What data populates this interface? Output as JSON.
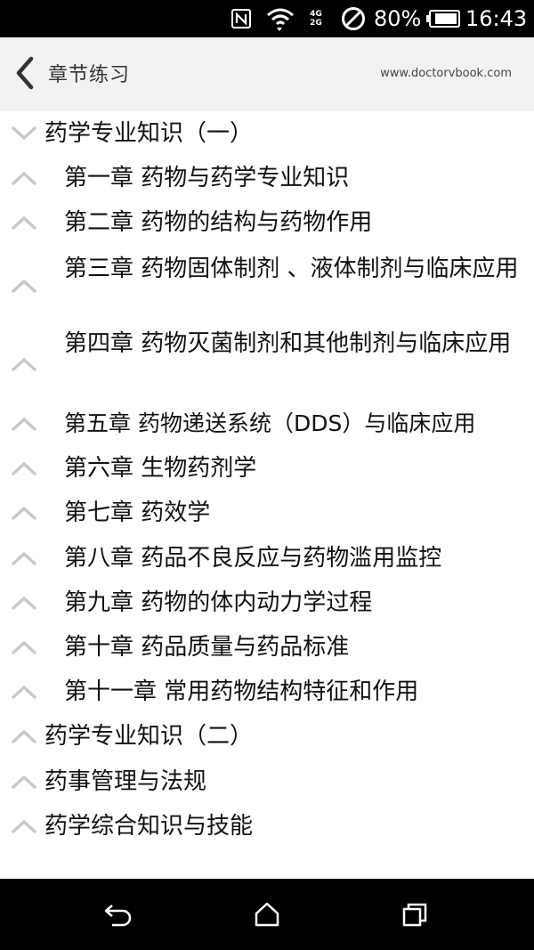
{
  "status_bar": {
    "battery_percent": "80%",
    "time": "16:43",
    "net_top": "4G",
    "net_bottom": "2G",
    "icons": [
      "nfc-icon",
      "wifi-icon",
      "cellular-signal-icon",
      "do-not-disturb-icon",
      "battery-icon"
    ]
  },
  "header": {
    "title": "章节练习",
    "site": "www.doctorvbook.com",
    "back_icon": "chevron-left-icon",
    "background": "#f2f2f2"
  },
  "tree": [
    {
      "label": "药学专业知识（一）",
      "level": 0,
      "expanded": true
    },
    {
      "label": "第一章 药物与药学专业知识",
      "level": 1,
      "expanded": false
    },
    {
      "label": "第二章 药物的结构与药物作用",
      "level": 1,
      "expanded": false
    },
    {
      "label": "第三章 药物固体制剂 、液体制剂与临床应用",
      "level": 1,
      "expanded": false
    },
    {
      "label": "第四章 药物灭菌制剂和其他制剂与临床应用",
      "level": 1,
      "expanded": false
    },
    {
      "label": "第五章 药物递送系统（DDS）与临床应用",
      "level": 1,
      "expanded": false
    },
    {
      "label": "第六章 生物药剂学",
      "level": 1,
      "expanded": false
    },
    {
      "label": "第七章 药效学",
      "level": 1,
      "expanded": false
    },
    {
      "label": "第八章 药品不良反应与药物滥用监控",
      "level": 1,
      "expanded": false
    },
    {
      "label": "第九章 药物的体内动力学过程",
      "level": 1,
      "expanded": false
    },
    {
      "label": "第十章 药品质量与药品标准",
      "level": 1,
      "expanded": false
    },
    {
      "label": "第十一章 常用药物结构特征和作用",
      "level": 1,
      "expanded": false
    },
    {
      "label": "药学专业知识（二）",
      "level": 0,
      "expanded": false
    },
    {
      "label": "药事管理与法规",
      "level": 0,
      "expanded": false
    },
    {
      "label": "药学综合知识与技能",
      "level": 0,
      "expanded": false
    }
  ],
  "nav_bar": {
    "icons": [
      "back-arrow-icon",
      "home-icon",
      "recent-apps-icon"
    ]
  }
}
